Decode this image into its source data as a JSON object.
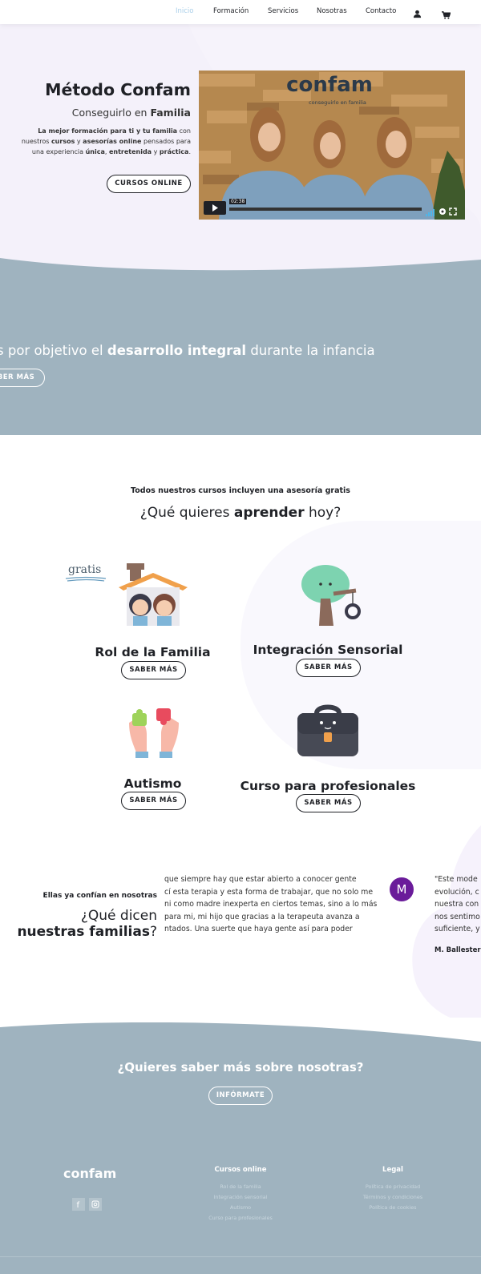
{
  "nav": {
    "items": [
      "Inicio",
      "Formación",
      "Servicios",
      "Nosotras",
      "Contacto"
    ],
    "active_color": "#a9cfe9"
  },
  "hero": {
    "title": "Método Confam",
    "subtitle_pre": "Conseguirlo en ",
    "subtitle_bold": "Familia",
    "desc": [
      {
        "b": "La mejor formación para ti y tu familia"
      },
      {
        "t": " con nuestros "
      },
      {
        "b": "cursos"
      },
      {
        "t": " y "
      },
      {
        "b": "asesorías online"
      },
      {
        "t": " pensados para una experiencia "
      },
      {
        "b": "única"
      },
      {
        "t": ", "
      },
      {
        "b": "entretenida"
      },
      {
        "t": " y "
      },
      {
        "b": "práctica"
      },
      {
        "t": "."
      }
    ],
    "button": "CURSOS ONLINE",
    "video": {
      "logo": "confam",
      "logo_sub": "conseguirlo en familia",
      "time": "02:38"
    }
  },
  "band": {
    "text_pre": "s por objetivo el ",
    "text_bold": "desarrollo integral",
    "text_post": " durante la infancia",
    "button": "BER MÁS",
    "color": "#9fb3bf"
  },
  "courses": {
    "intro": "Todos nuestros cursos incluyen una asesoría gratis",
    "q_pre": "¿Qué quieres ",
    "q_bold": "aprender",
    "q_post": " hoy?",
    "gratis_label": "gratis",
    "items": [
      {
        "title": "Rol de la Familia",
        "button": "SABER MÁS",
        "icon": "house-family-icon"
      },
      {
        "title": "Integración Sensorial",
        "button": "SABER MÁS",
        "icon": "tree-swing-icon"
      },
      {
        "title": "Autismo",
        "button": "SABER MÁS",
        "icon": "puzzle-hands-icon"
      },
      {
        "title": "Curso para profesionales",
        "button": "SABER MÁS",
        "icon": "briefcase-icon"
      }
    ]
  },
  "testimonials": {
    "small": "Ellas ya confían en nosotras",
    "big_pre": "¿Qué dicen ",
    "big_bold": "nuestras familias",
    "big_post": "?",
    "text_lines": [
      "que siempre hay que estar abierto a conocer gente",
      "cí esta terapia y esta forma de trabajar, que no solo me",
      "ni como madre inexperta en ciertos temas, sino a lo más",
      "para mi, mi hijo que gracias a la terapeuta avanza a",
      "ntados. Una suerte que haya gente así para poder"
    ],
    "avatar_letter": "M",
    "avatar_color": "#6a1b9a",
    "quote_lines": [
      "\"Este mode",
      "evolución, c",
      "nuestra con",
      "nos sentimo",
      "suficiente, y"
    ],
    "author": "M. Ballester"
  },
  "cta": {
    "q_pre": "¿Quieres saber más sobre ",
    "q_bold": "nosotras",
    "q_post": "?",
    "button": "INFÓRMATE"
  },
  "footer": {
    "logo": "confam",
    "social": [
      "facebook-icon",
      "instagram-icon"
    ],
    "col1_title": "Cursos online",
    "col1_links": [
      "Rol de la familia",
      "Integración sensorial",
      "Autismo",
      "Curso para profesionales"
    ],
    "col2_title": "Legal",
    "col2_links": [
      "Política de privacidad",
      "Términos y condiciones",
      "Política de cookies"
    ]
  }
}
